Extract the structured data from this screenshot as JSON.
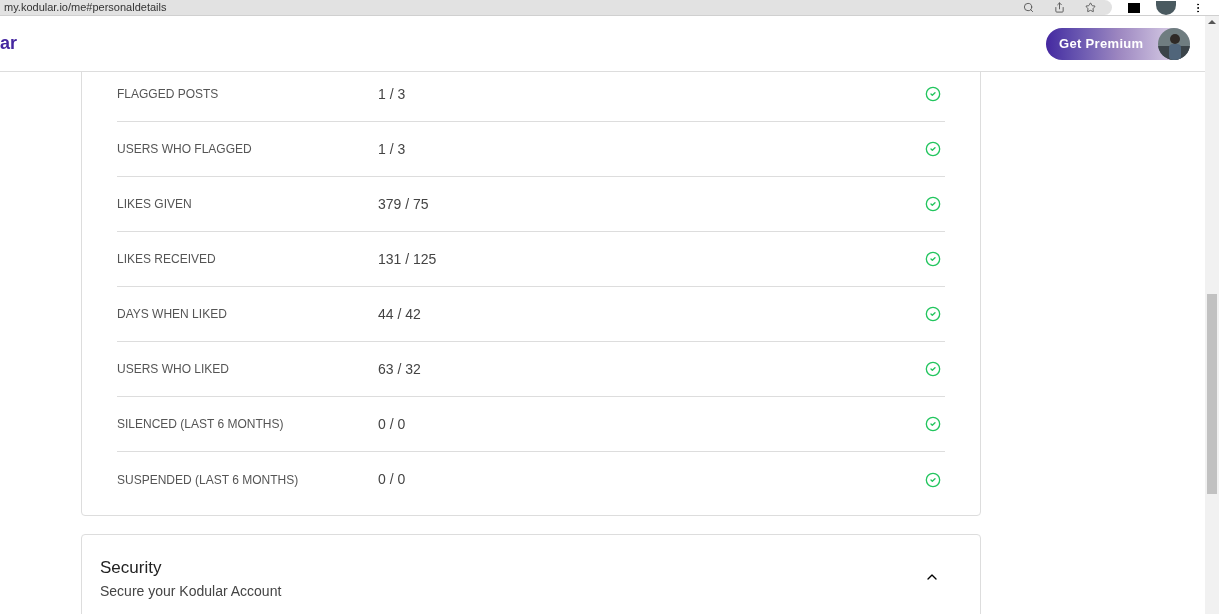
{
  "browser": {
    "url": "my.kodular.io/me#personaldetails"
  },
  "header": {
    "logo": "ar",
    "premium_button": "Get Premium"
  },
  "requirements": [
    {
      "label": "FLAGGED POSTS",
      "value": "1 / 3",
      "met": true
    },
    {
      "label": "USERS WHO FLAGGED",
      "value": "1 / 3",
      "met": true
    },
    {
      "label": "LIKES GIVEN",
      "value": "379 / 75",
      "met": true
    },
    {
      "label": "LIKES RECEIVED",
      "value": "131 / 125",
      "met": true
    },
    {
      "label": "DAYS WHEN LIKED",
      "value": "44 / 42",
      "met": true
    },
    {
      "label": "USERS WHO LIKED",
      "value": "63 / 32",
      "met": true
    },
    {
      "label": "SILENCED (LAST 6 MONTHS)",
      "value": "0 / 0",
      "met": true
    },
    {
      "label": "SUSPENDED (LAST 6 MONTHS)",
      "value": "0 / 0",
      "met": true
    }
  ],
  "security": {
    "title": "Security",
    "subtitle": "Secure your Kodular Account",
    "expanded": true
  }
}
